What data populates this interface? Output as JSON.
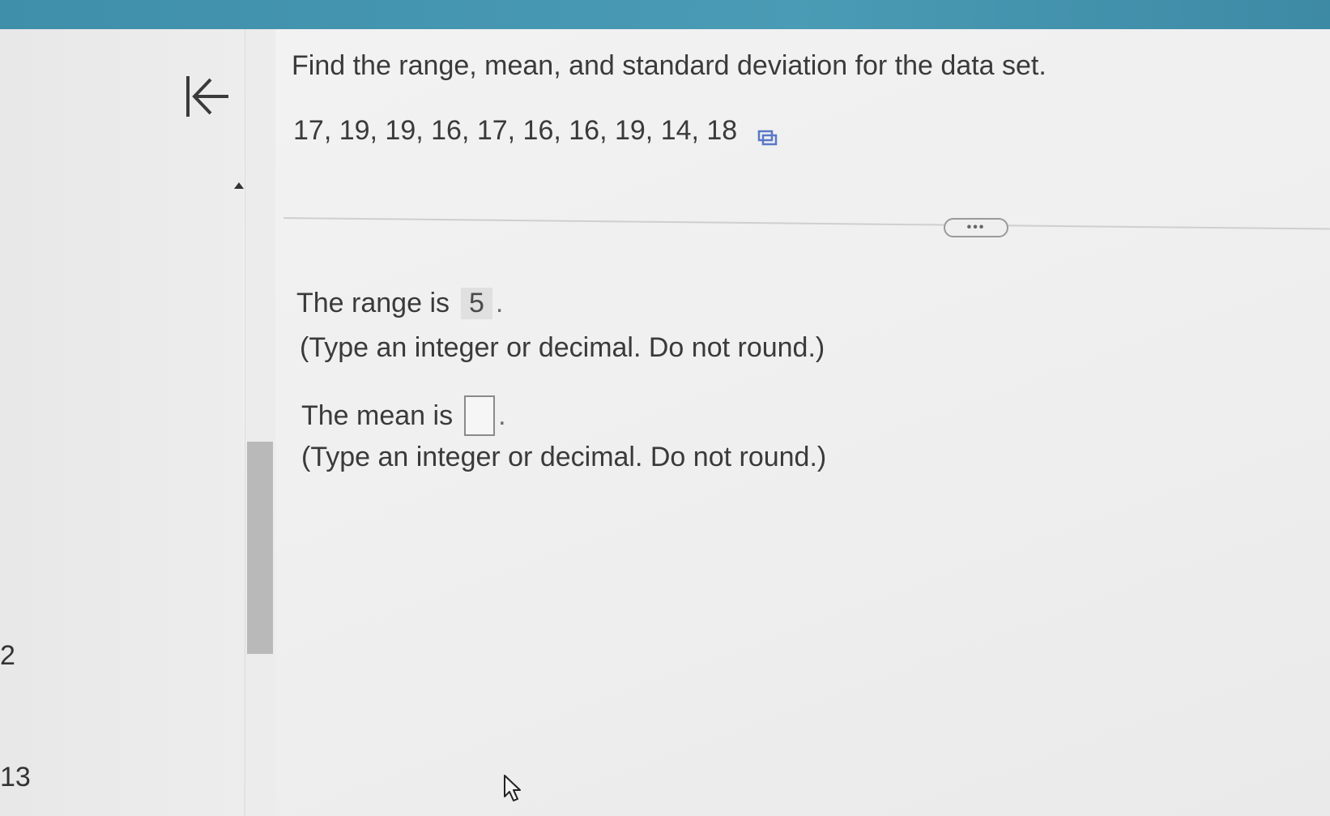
{
  "question": {
    "prompt": "Find the range, mean, and standard deviation for the data set.",
    "dataset": "17, 19, 19, 16, 17, 16, 16, 19, 14, 18",
    "copy_icon": "copy-icon"
  },
  "range": {
    "label": "The range is",
    "value": "5",
    "period": ".",
    "hint": "(Type an integer or decimal. Do not round.)"
  },
  "mean": {
    "label": "The mean is",
    "value": "",
    "period": ".",
    "hint": "(Type an integer or decimal. Do not round.)"
  },
  "more_button": {
    "label": "•••",
    "icon": "more-icon"
  },
  "sidebar": {
    "page_numbers": [
      "2",
      "13"
    ],
    "back_icon": "back-to-start-icon"
  },
  "colors": {
    "top_bar": "#4a9bb5",
    "background": "#eeeeee",
    "text": "#3a3a3a",
    "scroll_thumb": "#b9b9b9"
  }
}
